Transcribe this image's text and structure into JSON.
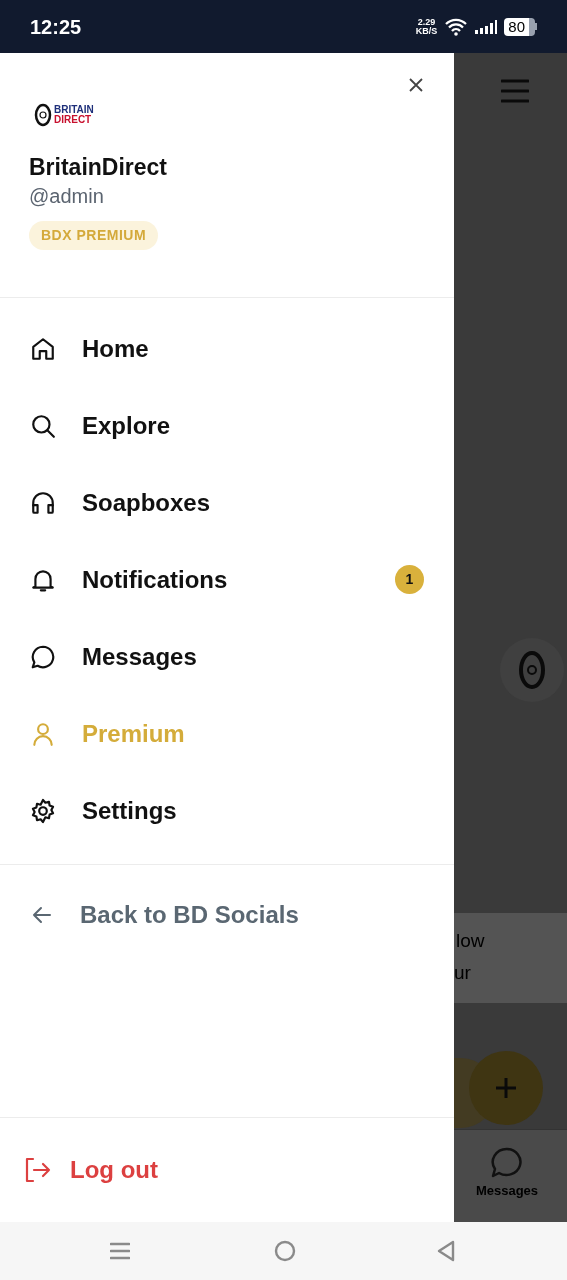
{
  "status_bar": {
    "time": "12:25",
    "speed_value": "2.29",
    "speed_unit": "KB/S",
    "battery": "80"
  },
  "drawer": {
    "logo": {
      "line_1": "BRITAIN",
      "line_2": "DIRECT"
    },
    "name": "BritainDirect",
    "handle": "@admin",
    "badge": "BDX PREMIUM",
    "menu": [
      {
        "kind": "home",
        "label": "Home",
        "accent": false
      },
      {
        "kind": "search",
        "label": "Explore",
        "accent": false
      },
      {
        "kind": "headset",
        "label": "Soapboxes",
        "accent": false
      },
      {
        "kind": "bell",
        "label": "Notifications",
        "accent": false,
        "count": "1"
      },
      {
        "kind": "chat",
        "label": "Messages",
        "accent": false
      },
      {
        "kind": "user",
        "label": "Premium",
        "accent": true
      },
      {
        "kind": "gear",
        "label": "Settings",
        "accent": false
      }
    ],
    "back_link": "Back to BD Socials",
    "logout": "Log out"
  },
  "background": {
    "text_1": "low",
    "text_2": "ur",
    "tab_label": "Messages"
  }
}
